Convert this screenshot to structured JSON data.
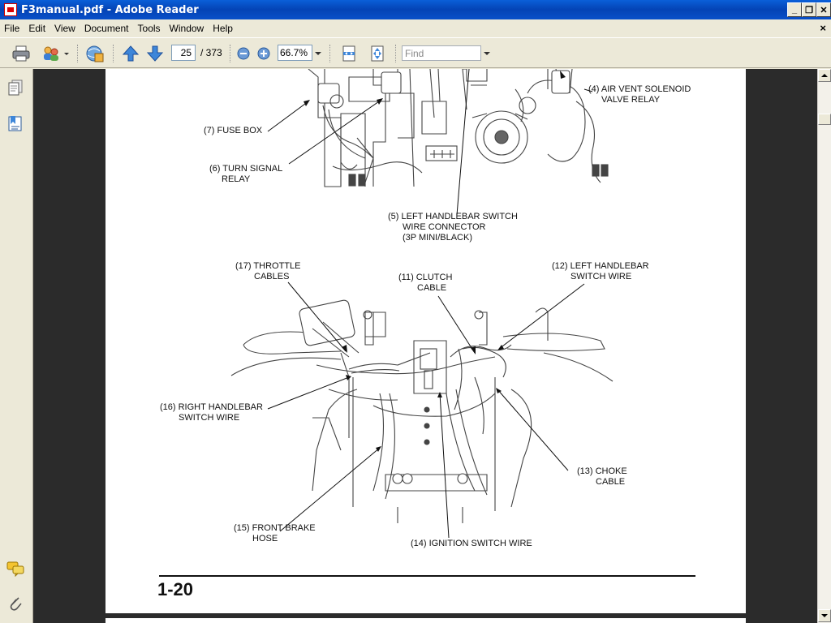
{
  "window": {
    "title": "F3manual.pdf - Adobe Reader",
    "min_label": "_",
    "restore_label": "❐",
    "close_label": "✕"
  },
  "menu": {
    "items": [
      "File",
      "Edit",
      "View",
      "Document",
      "Tools",
      "Window",
      "Help"
    ],
    "close_doc": "×"
  },
  "toolbar": {
    "page_current": "25",
    "page_total": "/ 373",
    "zoom": "66.7%",
    "find_placeholder": "Find"
  },
  "diagram": {
    "top_labels": {
      "air_vent_1": "(4) AIR VENT SOLENOID",
      "air_vent_2": "VALVE RELAY",
      "fuse_box": "(7) FUSE BOX",
      "turn_signal_1": "(6) TURN SIGNAL",
      "turn_signal_2": "RELAY",
      "left_switch_conn_1": "(5) LEFT HANDLEBAR SWITCH",
      "left_switch_conn_2": "WIRE CONNECTOR",
      "left_switch_conn_3": "(3P MINI/BLACK)"
    },
    "bottom_labels": {
      "throttle_1": "(17) THROTTLE",
      "throttle_2": "CABLES",
      "clutch_1": "(11) CLUTCH",
      "clutch_2": "CABLE",
      "left_switch_wire_1": "(12) LEFT HANDLEBAR",
      "left_switch_wire_2": "SWITCH WIRE",
      "right_switch_wire_1": "(16) RIGHT HANDLEBAR",
      "right_switch_wire_2": "SWITCH WIRE",
      "choke_1": "(13) CHOKE",
      "choke_2": "CABLE",
      "brake_hose_1": "(15) FRONT BRAKE",
      "brake_hose_2": "HOSE",
      "ignition_wire": "(14) IGNITION SWITCH WIRE"
    },
    "page_number": "1-20"
  }
}
